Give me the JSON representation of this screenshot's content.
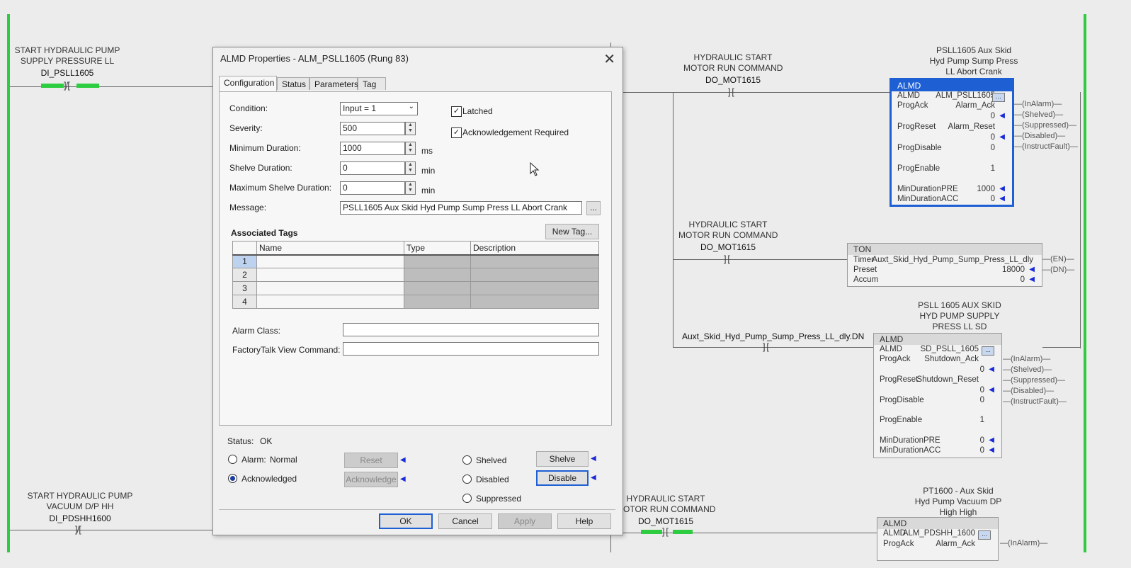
{
  "ladder": {
    "left_rung_top": {
      "title_lines": [
        "START HYDRAULIC PUMP",
        "SUPPLY PRESSURE LL"
      ],
      "tag": "DI_PSLL1605"
    },
    "left_rung_bottom": {
      "title_lines": [
        "START HYDRAULIC PUMP",
        "VACUUM D/P HH"
      ],
      "tag": "DI_PDSHH1600"
    },
    "contact_a": {
      "title_lines": [
        "HYDRAULIC START",
        "MOTOR RUN COMMAND"
      ],
      "tag": "DO_MOT1615"
    },
    "contact_b": {
      "title_lines": [
        "HYDRAULIC START",
        "MOTOR RUN COMMAND"
      ],
      "tag": "DO_MOT1615"
    },
    "contact_c": {
      "tag": "Auxt_Skid_Hyd_Pump_Sump_Press_LL_dly.DN"
    },
    "contact_d": {
      "title_lines": [
        "HYDRAULIC START",
        "MOTOR RUN COMMAND"
      ],
      "tag": "DO_MOT1615"
    },
    "almd1": {
      "desc_lines": [
        "PSLL1605 Aux Skid",
        "Hyd Pump Sump Press",
        "LL Abort Crank"
      ],
      "header": "ALMD",
      "rows": [
        {
          "k": "ALMD",
          "v": "ALM_PSLL1605"
        },
        {
          "k": "ProgAck",
          "v": "Alarm_Ack"
        },
        {
          "k": "",
          "v": "0"
        },
        {
          "k": "ProgReset",
          "v": "Alarm_Reset"
        },
        {
          "k": "",
          "v": "0"
        },
        {
          "k": "ProgDisable",
          "v": "0"
        },
        {
          "k": "ProgEnable",
          "v": "1"
        },
        {
          "k": "MinDurationPRE",
          "v": "1000"
        },
        {
          "k": "MinDurationACC",
          "v": "0"
        }
      ],
      "outputs": [
        "InAlarm",
        "Shelved",
        "Suppressed",
        "Disabled",
        "InstructFault"
      ]
    },
    "ton": {
      "header": "TON",
      "rows": [
        {
          "k": "Timer",
          "v": "Auxt_Skid_Hyd_Pump_Sump_Press_LL_dly"
        },
        {
          "k": "Preset",
          "v": "18000"
        },
        {
          "k": "Accum",
          "v": "0"
        }
      ],
      "outputs": [
        "EN",
        "DN"
      ]
    },
    "almd2": {
      "desc_lines": [
        "PSLL 1605 AUX SKID",
        "HYD PUMP SUPPLY",
        "PRESS LL SD"
      ],
      "header": "ALMD",
      "rows": [
        {
          "k": "ALMD",
          "v": "SD_PSLL_1605"
        },
        {
          "k": "ProgAck",
          "v": "Shutdown_Ack"
        },
        {
          "k": "",
          "v": "0"
        },
        {
          "k": "ProgReset",
          "v": "Shutdown_Reset"
        },
        {
          "k": "",
          "v": "0"
        },
        {
          "k": "ProgDisable",
          "v": "0"
        },
        {
          "k": "ProgEnable",
          "v": "1"
        },
        {
          "k": "MinDurationPRE",
          "v": "0"
        },
        {
          "k": "MinDurationACC",
          "v": "0"
        }
      ],
      "outputs": [
        "InAlarm",
        "Shelved",
        "Suppressed",
        "Disabled",
        "InstructFault"
      ]
    },
    "almd3": {
      "desc_lines": [
        "PT1600 - Aux Skid",
        "Hyd Pump Vacuum DP",
        "High High"
      ],
      "header": "ALMD",
      "rows": [
        {
          "k": "ALMD",
          "v": "ALM_PDSHH_1600"
        },
        {
          "k": "ProgAck",
          "v": "Alarm_Ack"
        }
      ],
      "outputs": [
        "InAlarm"
      ]
    }
  },
  "dialog": {
    "title": "ALMD Properties - ALM_PSLL1605 (Rung 83)",
    "close_glyph": "✕",
    "tabs": [
      "Configuration",
      "Status",
      "Parameters",
      "Tag"
    ],
    "condition_label": "Condition:",
    "condition_value": "Input = 1",
    "severity_label": "Severity:",
    "severity_value": "500",
    "min_duration_label": "Minimum Duration:",
    "min_duration_value": "1000",
    "min_duration_unit": "ms",
    "shelve_duration_label": "Shelve Duration:",
    "shelve_duration_value": "0",
    "shelve_duration_unit": "min",
    "max_shelve_label": "Maximum Shelve Duration:",
    "max_shelve_value": "0",
    "max_shelve_unit": "min",
    "message_label": "Message:",
    "message_value": "PSLL1605 Aux Skid Hyd Pump Sump Press LL Abort Crank",
    "message_button": "...",
    "latched_label": "Latched",
    "ack_required_label": "Acknowledgement Required",
    "associated_tags_label": "Associated Tags",
    "new_tag_button": "New Tag...",
    "grid_headers": [
      "Name",
      "Type",
      "Description"
    ],
    "grid_rows": [
      "1",
      "2",
      "3",
      "4"
    ],
    "alarm_class_label": "Alarm Class:",
    "ft_view_label": "FactoryTalk View Command:",
    "status_label": "Status:",
    "status_value": "OK",
    "alarm_label": "Alarm:",
    "alarm_value": "Normal",
    "acknowledged_label": "Acknowledged",
    "shelved_label": "Shelved",
    "disabled_label": "Disabled",
    "suppressed_label": "Suppressed",
    "reset_button": "Reset",
    "acknowledge_button": "Acknowledge",
    "shelve_button": "Shelve",
    "disable_button": "Disable",
    "ok_button": "OK",
    "cancel_button": "Cancel",
    "apply_button": "Apply",
    "help_button": "Help"
  }
}
